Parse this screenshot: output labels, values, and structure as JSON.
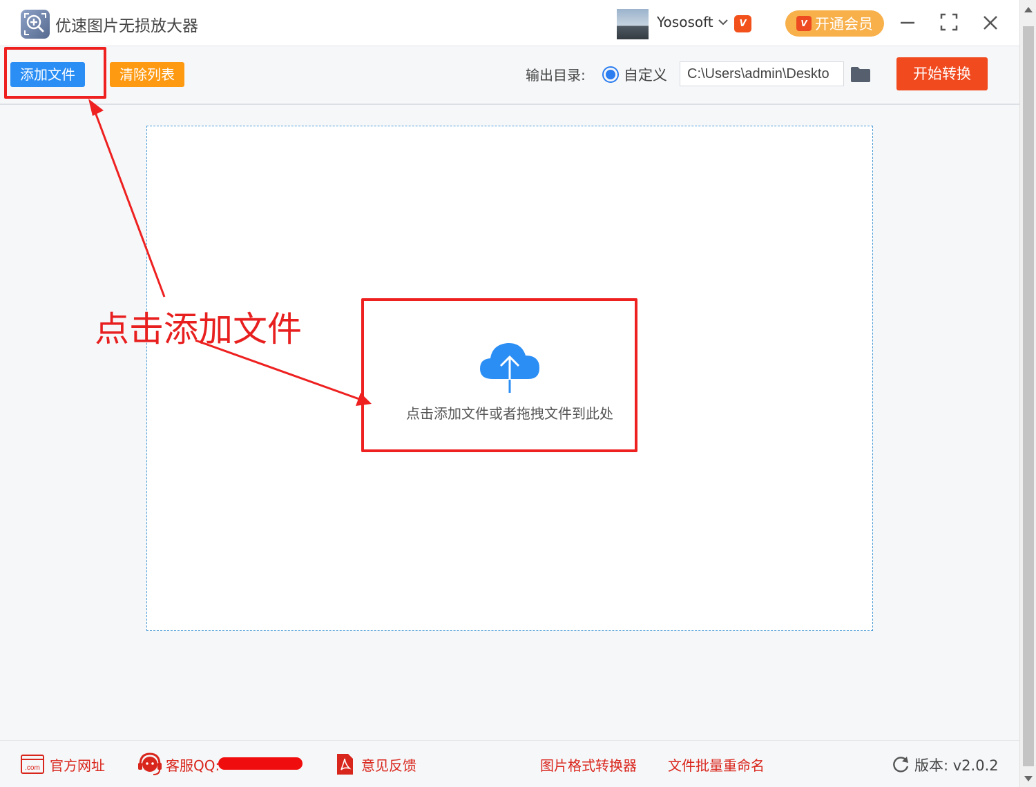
{
  "app": {
    "title": "优速图片无损放大器",
    "username": "Yososoft",
    "vip_badge": "V",
    "member_button": "开通会员"
  },
  "toolbar": {
    "add_files": "添加文件",
    "clear_list": "清除列表",
    "output_label": "输出目录:",
    "radio_custom": "自定义",
    "output_path": "C:\\Users\\admin\\Deskto",
    "start": "开始转换"
  },
  "dropzone": {
    "hint": "点击添加文件或者拖拽文件到此处"
  },
  "annotation": {
    "text": "点击添加文件",
    "color": "#e81f1f"
  },
  "footer": {
    "website": "官方网址",
    "website_icon_text": ".com",
    "support": "客服QQ:",
    "feedback": "意见反馈",
    "converter": "图片格式转换器",
    "rename": "文件批量重命名",
    "version": "版本:  v2.0.2"
  },
  "colors": {
    "primary_blue": "#2b8ef5",
    "orange": "#fd9a12",
    "start_red": "#f04a1e",
    "member_orange": "#f8b04b",
    "footer_red": "#d9261c"
  },
  "icons": [
    "app-logo-icon",
    "chevron-down-icon",
    "vip-icon",
    "minimize-icon",
    "maximize-icon",
    "close-icon",
    "folder-icon",
    "cloud-upload-icon",
    "website-icon",
    "headset-icon",
    "pdf-icon",
    "refresh-icon"
  ]
}
